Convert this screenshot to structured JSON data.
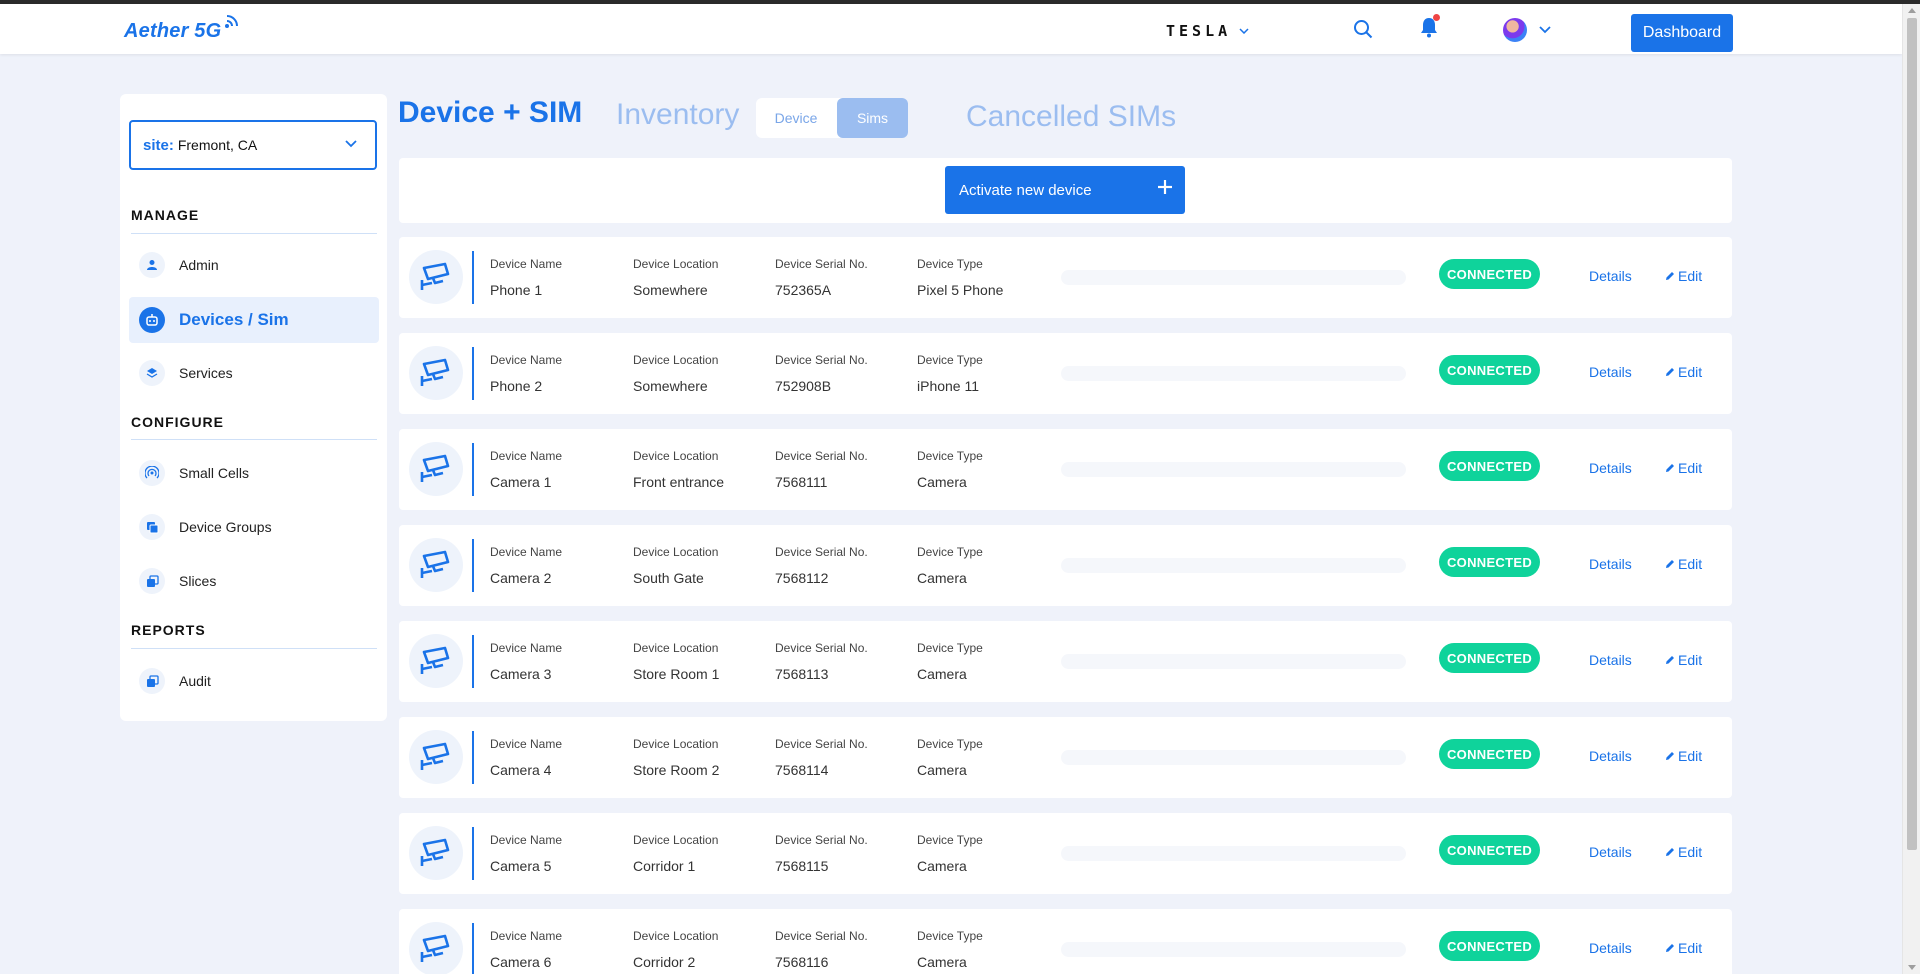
{
  "header": {
    "logo_text": "Aether 5G",
    "brand": "TESLA",
    "dashboard_label": "Dashboard"
  },
  "sidebar": {
    "site_label": "site:",
    "site_value": "Fremont, CA",
    "sections": {
      "manage": "MANAGE",
      "configure": "CONFIGURE",
      "reports": "REPORTS"
    },
    "items": [
      {
        "label": "Admin",
        "icon": "user-icon",
        "active": false
      },
      {
        "label": "Devices / Sim",
        "icon": "robot-icon",
        "active": true
      },
      {
        "label": "Services",
        "icon": "layers-icon",
        "active": false
      },
      {
        "label": "Small Cells",
        "icon": "signal-icon",
        "active": false
      },
      {
        "label": "Device Groups",
        "icon": "copy-icon",
        "active": false
      },
      {
        "label": "Slices",
        "icon": "stack-icon",
        "active": false
      },
      {
        "label": "Audit",
        "icon": "stack-icon",
        "active": false
      }
    ]
  },
  "main": {
    "title": "Device + SIM",
    "tab_inventory": "Inventory",
    "toggle_device": "Device",
    "toggle_sims": "Sims",
    "tab_cancelled": "Cancelled SIMs",
    "activate_label": "Activate new device",
    "columns": {
      "name": "Device Name",
      "location": "Device Location",
      "serial": "Device Serial No.",
      "type": "Device Type"
    },
    "details_label": "Details",
    "edit_label": "Edit",
    "devices": [
      {
        "name": "Phone 1",
        "location": "Somewhere",
        "serial": "752365A",
        "type": "Pixel 5 Phone",
        "status": "CONNECTED",
        "usage": 0
      },
      {
        "name": "Phone 2",
        "location": "Somewhere",
        "serial": "752908B",
        "type": "iPhone 11",
        "status": "CONNECTED",
        "usage": 0
      },
      {
        "name": "Camera 1",
        "location": "Front entrance",
        "serial": "7568111",
        "type": "Camera",
        "status": "CONNECTED",
        "usage": 0
      },
      {
        "name": "Camera 2",
        "location": "South Gate",
        "serial": "7568112",
        "type": "Camera",
        "status": "CONNECTED",
        "usage": 0
      },
      {
        "name": "Camera 3",
        "location": "Store Room 1",
        "serial": "7568113",
        "type": "Camera",
        "status": "CONNECTED",
        "usage": 0
      },
      {
        "name": "Camera 4",
        "location": "Store Room 2",
        "serial": "7568114",
        "type": "Camera",
        "status": "CONNECTED",
        "usage": 0
      },
      {
        "name": "Camera 5",
        "location": "Corridor 1",
        "serial": "7568115",
        "type": "Camera",
        "status": "CONNECTED",
        "usage": 0
      },
      {
        "name": "Camera 6",
        "location": "Corridor 2",
        "serial": "7568116",
        "type": "Camera",
        "status": "CONNECTED",
        "usage": 0
      }
    ]
  },
  "colors": {
    "accent": "#1a73e8",
    "connected": "#0fd39b",
    "background": "#eff2fa",
    "muted_tab": "#9bbdf0"
  }
}
